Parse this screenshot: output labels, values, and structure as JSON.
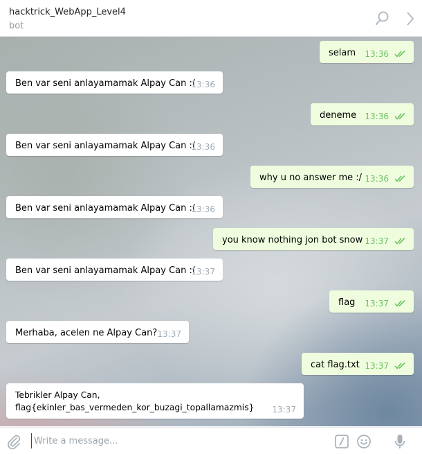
{
  "header": {
    "title": "hacktrick_WebApp_Level4",
    "subtitle": "bot",
    "icons": [
      "search-icon",
      "chevron-right-icon"
    ]
  },
  "messages": [
    {
      "dir": "out",
      "text": "selam",
      "time": "13:36"
    },
    {
      "dir": "in",
      "text": "Ben var seni anlayamamak Alpay Can :(",
      "time": "13:36"
    },
    {
      "dir": "out",
      "text": "deneme",
      "time": "13:36"
    },
    {
      "dir": "in",
      "text": "Ben var seni anlayamamak Alpay Can :(",
      "time": "13:36"
    },
    {
      "dir": "out",
      "text": "why u no answer me :/",
      "time": "13:36"
    },
    {
      "dir": "in",
      "text": "Ben var seni anlayamamak Alpay Can :(",
      "time": "13:36"
    },
    {
      "dir": "out",
      "text": "you know nothing jon bot snow",
      "time": "13:37"
    },
    {
      "dir": "in",
      "text": "Ben var seni anlayamamak Alpay Can :(",
      "time": "13:37"
    },
    {
      "dir": "out",
      "text": "flag",
      "time": "13:37"
    },
    {
      "dir": "in",
      "text": "Merhaba, acelen ne Alpay Can?",
      "time": "13:37"
    },
    {
      "dir": "out",
      "text": "cat flag.txt",
      "time": "13:37"
    },
    {
      "dir": "in",
      "text": "Tebrikler Alpay Can,\nflag{ekinler_bas_vermeden_kor_buzagi_topallamazmis}",
      "time": "13:37"
    }
  ],
  "composer": {
    "placeholder": "Write a message...",
    "value": "",
    "icons": [
      "attach-icon",
      "slash-command-icon",
      "emoji-icon",
      "microphone-icon"
    ]
  },
  "colors": {
    "outgoing_bubble": "#effdde",
    "incoming_bubble": "#ffffff",
    "read_ticks": "#6cc264",
    "time_incoming": "#a0acb6"
  }
}
